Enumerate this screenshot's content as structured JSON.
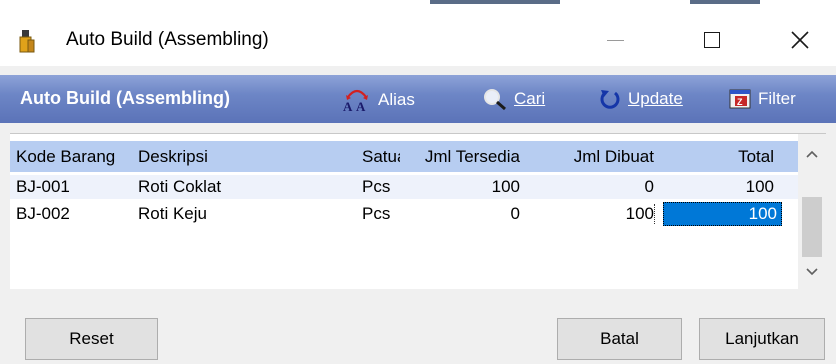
{
  "window": {
    "title": "Auto Build (Assembling)",
    "controls": {
      "minimize_icon": "minimize-icon",
      "maximize_icon": "maximize-icon",
      "close_icon": "close-icon"
    }
  },
  "toolbar": {
    "title": "Auto Build (Assembling)",
    "alias_label": "Alias",
    "cari_label": "Cari",
    "update_label": "Update",
    "filter_label": "Filter"
  },
  "grid": {
    "columns": [
      "Kode Barang",
      "Deskripsi",
      "Satuan",
      "Jml Tersedia",
      "Jml Dibuat",
      "Total"
    ],
    "rows": [
      {
        "kode": "BJ-001",
        "deskripsi": "Roti Coklat",
        "satuan": "Pcs",
        "jml_tersedia": "100",
        "jml_dibuat": "0",
        "total": "100"
      },
      {
        "kode": "BJ-002",
        "deskripsi": "Roti Keju",
        "satuan": "Pcs",
        "jml_tersedia": "0",
        "jml_dibuat": "100",
        "total": "100"
      }
    ]
  },
  "buttons": {
    "reset": "Reset",
    "batal": "Batal",
    "lanjutkan": "Lanjutkan"
  },
  "colors": {
    "toolbar_top": "#8ea3d8",
    "toolbar_bottom": "#5b73b8",
    "header_bg": "#b7cdf1",
    "selection": "#0078d7"
  }
}
